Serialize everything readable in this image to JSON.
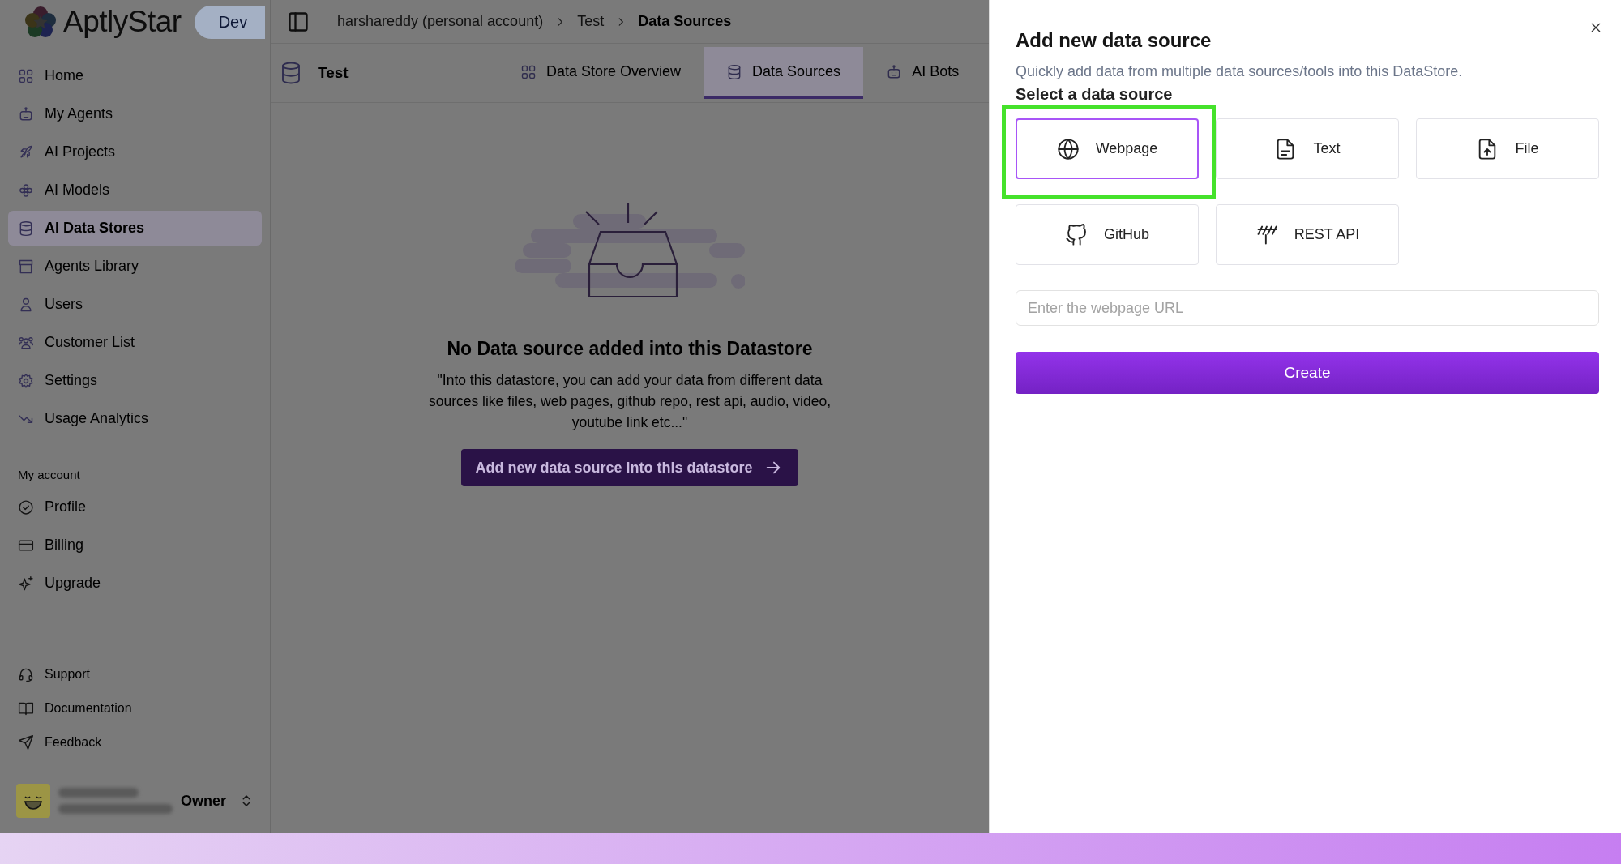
{
  "app": {
    "logo": "AptlyStar",
    "env_badge": "Dev"
  },
  "breadcrumb": [
    {
      "label": "harshareddy (personal account)",
      "current": false
    },
    {
      "label": "Test",
      "current": false
    },
    {
      "label": "Data Sources",
      "current": true
    }
  ],
  "sidebar": {
    "items": [
      {
        "label": "Home",
        "selected": false
      },
      {
        "label": "My Agents",
        "selected": false
      },
      {
        "label": "AI Projects",
        "selected": false
      },
      {
        "label": "AI Models",
        "selected": false
      },
      {
        "label": "AI Data Stores",
        "selected": true
      },
      {
        "label": "Agents Library",
        "selected": false
      },
      {
        "label": "Users",
        "selected": false
      },
      {
        "label": "Customer List",
        "selected": false
      },
      {
        "label": "Settings",
        "selected": false
      },
      {
        "label": "Usage Analytics",
        "selected": false
      }
    ],
    "account_heading": "My account",
    "account_items": [
      {
        "label": "Profile"
      },
      {
        "label": "Billing"
      },
      {
        "label": "Upgrade"
      }
    ],
    "footer_items": [
      {
        "label": "Support"
      },
      {
        "label": "Documentation"
      },
      {
        "label": "Feedback"
      }
    ],
    "user": {
      "role": "Owner"
    }
  },
  "datastore": {
    "name": "Test",
    "tabs": [
      {
        "label": "Data Store Overview",
        "selected": false
      },
      {
        "label": "Data Sources",
        "selected": true
      },
      {
        "label": "AI Bots",
        "selected": false
      }
    ]
  },
  "empty_state": {
    "title": "No Data source added into this Datastore",
    "message": "\"Into this datastore, you can add your data from different data sources like files, web pages, github repo, rest api, audio, video, youtube link etc...\"",
    "button": "Add new data source into this datastore"
  },
  "panel": {
    "title": "Add new data source",
    "subtitle": "Quickly add data from multiple data sources/tools into this DataStore.",
    "section_label": "Select a data source",
    "sources": [
      {
        "label": "Webpage",
        "selected": true,
        "highlighted": true
      },
      {
        "label": "Text",
        "selected": false,
        "highlighted": false
      },
      {
        "label": "File",
        "selected": false,
        "highlighted": false
      },
      {
        "label": "GitHub",
        "selected": false,
        "highlighted": false
      },
      {
        "label": "REST API",
        "selected": false,
        "highlighted": false
      }
    ],
    "url_field": {
      "placeholder": "Enter the webpage URL"
    },
    "create_button": "Create"
  }
}
